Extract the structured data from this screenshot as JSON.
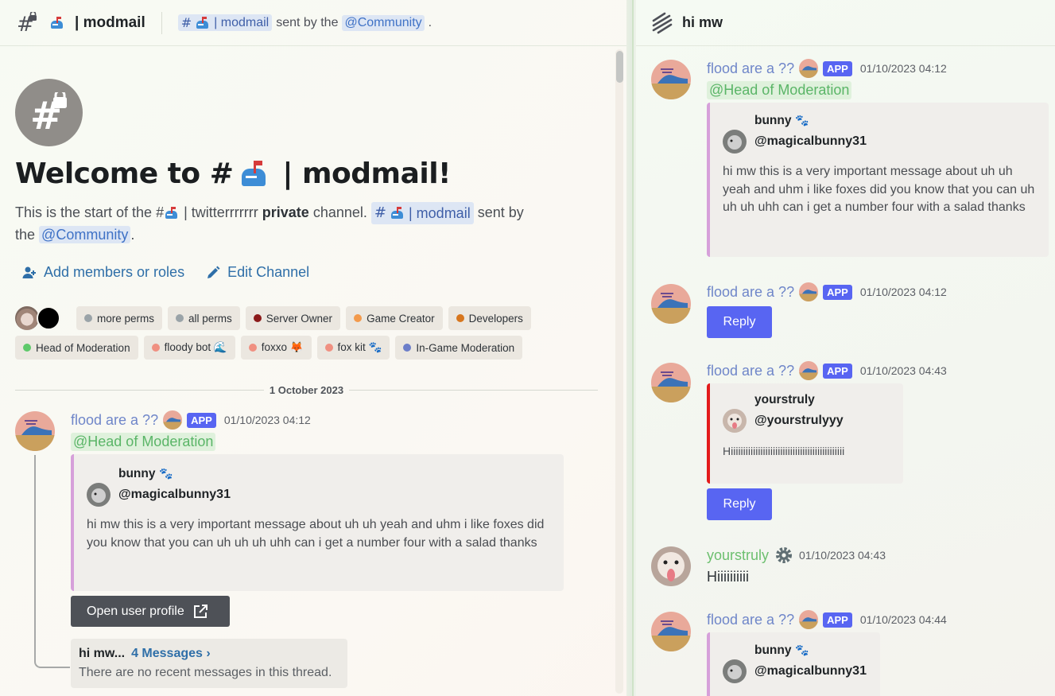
{
  "header": {
    "channel_name": "| modmail",
    "topic": {
      "channel_mention": "| modmail",
      "mid_text": "sent by the",
      "role_mention": "@Community",
      "end": "."
    }
  },
  "welcome": {
    "title_prefix": "Welcome to #",
    "title_suffix": "| modmail!",
    "desc_part1": "This is the start of the #",
    "desc_part2": "| twitterrrrrrr",
    "desc_private": "private",
    "desc_part3": "channel.",
    "desc_channel": "| modmail",
    "desc_part4": "sent by",
    "desc_part5": "the",
    "desc_role": "@Community",
    "desc_end": "."
  },
  "actions": {
    "add_members": "Add members or roles",
    "edit_channel": "Edit Channel"
  },
  "roles": [
    {
      "label": "more perms",
      "color": "#9aa3a8"
    },
    {
      "label": "all perms",
      "color": "#9aa3a8"
    },
    {
      "label": "Server Owner",
      "color": "#8b1a1a"
    },
    {
      "label": "Game Creator",
      "color": "#f39a4c"
    },
    {
      "label": "Developers",
      "color": "#d7761e"
    },
    {
      "label": "Head of Moderation",
      "color": "#5ec96a"
    },
    {
      "label": "floody bot 🌊",
      "color": "#f09081"
    },
    {
      "label": "foxxo 🦊",
      "color": "#f09081"
    },
    {
      "label": "fox kit 🐾",
      "color": "#f09081"
    },
    {
      "label": "In-Game Moderation",
      "color": "#6c7ec9"
    }
  ],
  "date_separator": "1 October 2023",
  "left_message": {
    "author": "flood are a ??",
    "app_tag": "APP",
    "timestamp": "01/10/2023 04:12",
    "role_mention": "@Head of Moderation",
    "embed": {
      "name": "bunny",
      "handle": "@magicalbunny31",
      "text": "hi mw this is a very important message about uh uh yeah and uhm i like foxes did you know that you can uh uh uh uhh can i get a number four with a salad thanks"
    },
    "button": "Open user profile",
    "thread": {
      "title": "hi mw...",
      "link": "4 Messages ›",
      "subtitle": "There are no recent messages in this thread."
    }
  },
  "right_panel": {
    "title": "hi mw",
    "messages": [
      {
        "author": "flood are a ??",
        "app_tag": "APP",
        "timestamp": "01/10/2023 04:12",
        "role_mention": "@Head of Moderation",
        "embed_name": "bunny",
        "embed_handle": "@magicalbunny31",
        "embed_text": "hi mw this is a very important message about uh uh yeah and uhm i like foxes did you know that you can uh uh uh uhh can i get a number four with a salad thanks"
      },
      {
        "author": "flood are a ??",
        "app_tag": "APP",
        "timestamp": "01/10/2023 04:12",
        "button": "Reply"
      },
      {
        "author": "flood are a ??",
        "app_tag": "APP",
        "timestamp": "01/10/2023 04:43",
        "embed_name": "yourstruly",
        "embed_handle": "@yourstrulyyy",
        "embed_text": "Hiiiiiiiiiiiiiiiiiiiiiiiiiiiiiiiiiiiiiiiiiiiiii",
        "button": "Reply"
      },
      {
        "author": "yourstruly",
        "timestamp": "01/10/2023 04:43",
        "text": "Hiiiiiiiiii"
      },
      {
        "author": "flood are a ??",
        "app_tag": "APP",
        "timestamp": "01/10/2023 04:44",
        "embed_name": "bunny",
        "embed_handle": "@magicalbunny31"
      }
    ]
  },
  "colors": {
    "accent": "#5865f2",
    "author_bot": "#6f86c9",
    "author_user": "#6cbf6f",
    "embed_bar_default": "#d6a0da",
    "embed_bar_red": "#e31b1b"
  }
}
